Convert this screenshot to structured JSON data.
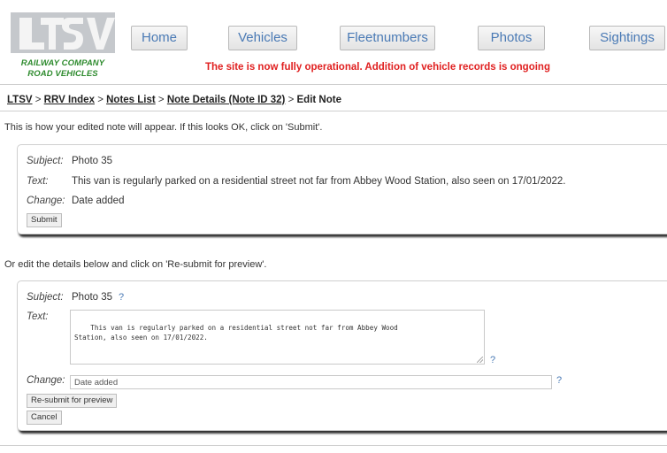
{
  "logo": {
    "text": "LTSV",
    "sub1": "RAILWAY COMPANY",
    "sub2": "ROAD VEHICLES"
  },
  "nav": [
    {
      "label": "Home"
    },
    {
      "label": "Vehicles"
    },
    {
      "label": "Fleetnumbers"
    },
    {
      "label": "Photos"
    },
    {
      "label": "Sightings"
    }
  ],
  "notice": "The site is now fully operational. Addition of vehicle records is ongoing",
  "breadcrumb": {
    "items": [
      "LTSV",
      "RRV Index",
      "Notes List",
      "Note Details (Note ID 32)"
    ],
    "separator": ">",
    "current": "Edit Note"
  },
  "preview": {
    "intro": "This is how your edited note will appear. If this looks OK, click on 'Submit'.",
    "subject_label": "Subject:",
    "subject_value": "Photo 35",
    "text_label": "Text:",
    "text_value": "This van is regularly parked on a residential street not far from Abbey Wood Station, also seen on 17/01/2022.",
    "change_label": "Change:",
    "change_value": "Date added",
    "submit_label": "Submit"
  },
  "edit": {
    "intro": "Or edit the details below and click on 'Re-submit for preview'.",
    "subject_label": "Subject:",
    "subject_value": "Photo 35",
    "text_label": "Text:",
    "text_value": "This van is regularly parked on a residential street not far from Abbey Wood\nStation, also seen on 17/01/2022.",
    "change_label": "Change:",
    "change_value": "Date added",
    "help": "?",
    "resubmit_label": "Re-submit for preview",
    "cancel_label": "Cancel"
  },
  "colors": {
    "accent": "#4a7ab5",
    "notice": "#e02020",
    "logo_green": "#2e8b2e",
    "logo_grey": "#8a8f96"
  }
}
